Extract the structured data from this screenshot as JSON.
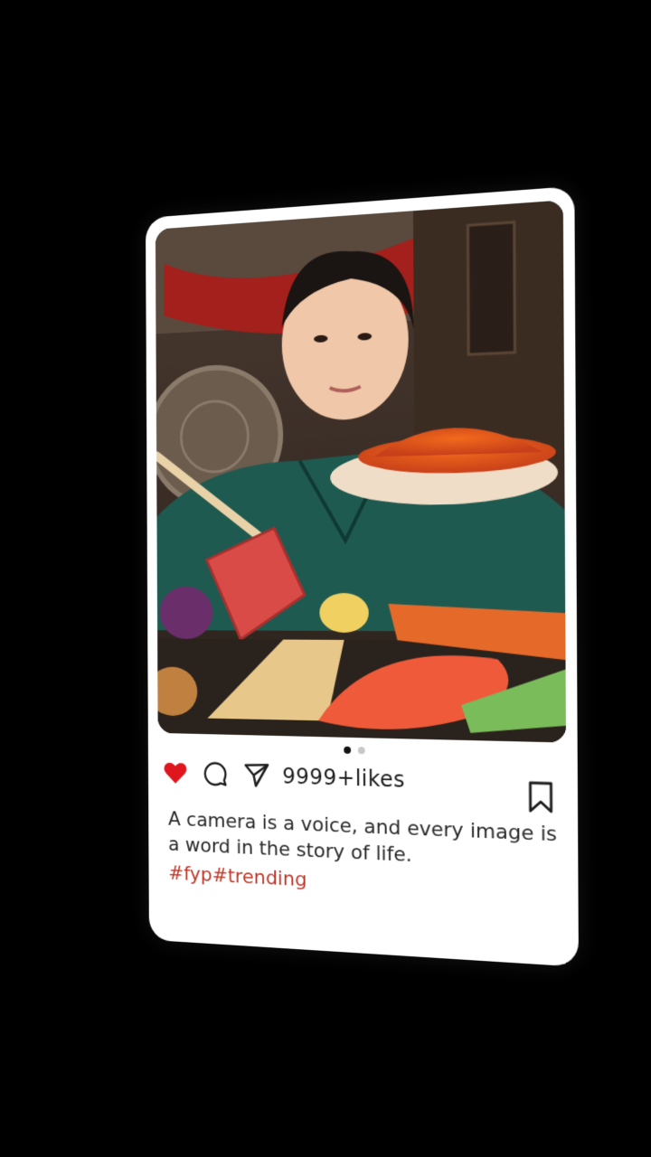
{
  "post": {
    "likes_label": "9999+likes",
    "caption": "A camera is a voice, and every image is a word in the story of life.",
    "hashtags": "#fyp#trending",
    "carousel": {
      "count": 2,
      "active_index": 0
    },
    "liked": true
  },
  "icons": {
    "like": "heart-icon",
    "comment": "comment-icon",
    "share": "paper-plane-icon",
    "save": "bookmark-icon"
  },
  "colors": {
    "background": "#000000",
    "card": "#ffffff",
    "heart": "#e0161e",
    "hashtag": "#c0392b",
    "text": "#2a2a2a"
  }
}
